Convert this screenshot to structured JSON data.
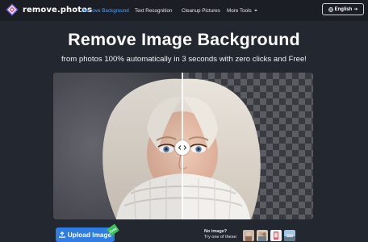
{
  "brand": {
    "name": "remove.photos"
  },
  "nav": {
    "links": [
      {
        "label": "Remove Background",
        "active": true
      },
      {
        "label": "Text Recognition",
        "active": false
      },
      {
        "label": "Cleanup Pictures",
        "active": false
      },
      {
        "label": "More Tools",
        "active": false
      }
    ],
    "language_label": "English",
    "language_icon": "globe-icon",
    "language_arrow_icon": "arrow-right-icon"
  },
  "hero": {
    "title": "Remove Image Background",
    "subtitle": "from photos 100% automatically in 3 seconds with zero clicks and Free!"
  },
  "demo": {
    "slider_icon": "compare-arrows-icon"
  },
  "upload": {
    "label": "Upload Image",
    "badge": "Free",
    "icon": "upload-icon"
  },
  "samples": {
    "line1": "No image?",
    "line2": "Try one of these:"
  },
  "colors": {
    "background": "#23272f",
    "navbar": "#1b1e25",
    "accent_link": "#4aa3ff",
    "upload_button": "#2f7de1",
    "badge": "#3fbf5a"
  }
}
